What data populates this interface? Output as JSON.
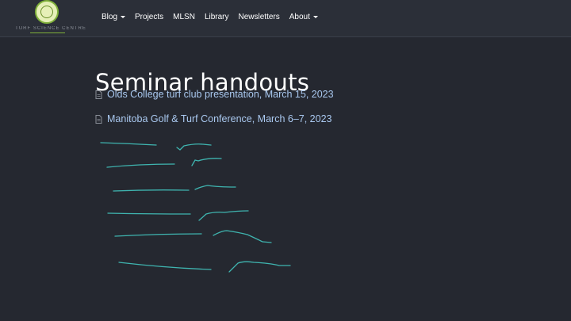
{
  "nav": {
    "brand_text": "TURF SCIENCE CENTRE",
    "items": [
      {
        "label": "Blog",
        "dropdown": true
      },
      {
        "label": "Projects",
        "dropdown": false
      },
      {
        "label": "MLSN",
        "dropdown": false
      },
      {
        "label": "Library",
        "dropdown": false
      },
      {
        "label": "Newsletters",
        "dropdown": false
      },
      {
        "label": "About",
        "dropdown": true
      }
    ]
  },
  "page": {
    "title": "Seminar handouts",
    "links": [
      {
        "label": "Olds College turf club presentation, March 15, 2023",
        "icon": "file-icon"
      },
      {
        "label": "Manitoba Golf & Turf Conference, March 6–7, 2023",
        "icon": "file-icon"
      }
    ]
  },
  "colors": {
    "background": "#252830",
    "navbar": "#2b2f38",
    "link": "#a9c8ef",
    "scribble": "#3fb5b0"
  }
}
